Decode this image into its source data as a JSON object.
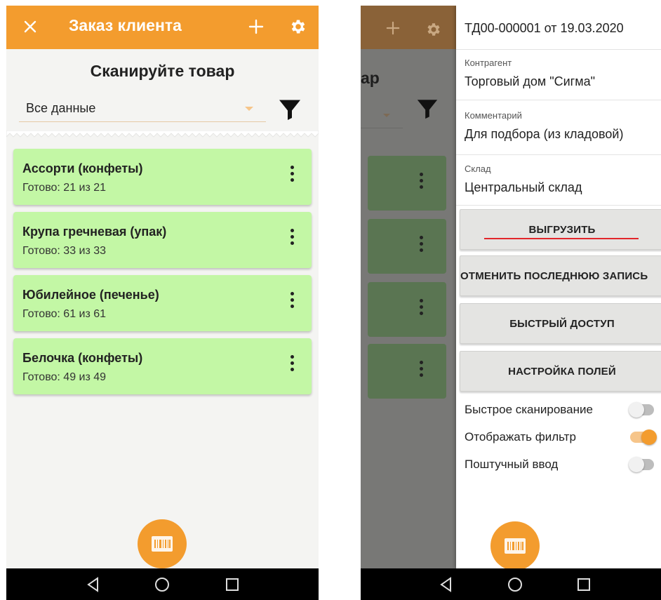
{
  "left": {
    "title": "Заказ клиента",
    "scan_title": "Сканируйте товар",
    "filter_value": "Все данные",
    "items": [
      {
        "title": "Ассорти (конфеты)",
        "status": "Готово: 21 из 21"
      },
      {
        "title": "Крупа гречневая (упак)",
        "status": "Готово: 33 из 33"
      },
      {
        "title": "Юбилейное (печенье)",
        "status": "Готово: 61 из 61"
      },
      {
        "title": "Белочка (конфеты)",
        "status": "Готово: 49 из 49"
      }
    ]
  },
  "right": {
    "bg_title_fragment": "ар",
    "drawer": {
      "document": "ТД00-000001 от 19.03.2020",
      "fields": [
        {
          "label": "Контрагент",
          "value": "Торговый дом \"Сигма\""
        },
        {
          "label": "Комментарий",
          "value": "Для подбора (из кладовой)"
        },
        {
          "label": "Склад",
          "value": "Центральный склад"
        }
      ],
      "buttons": [
        "ВЫГРУЗИТЬ",
        "ОТМЕНИТЬ ПОСЛЕДНЮЮ ЗАПИСЬ",
        "БЫСТРЫЙ ДОСТУП",
        "НАСТРОЙКА ПОЛЕЙ"
      ],
      "toggles": [
        {
          "label": "Быстрое сканирование",
          "state": "off"
        },
        {
          "label": "Отображать фильтр",
          "state": "on"
        },
        {
          "label": "Поштучный ввод",
          "state": "off"
        }
      ]
    }
  },
  "colors": {
    "accent": "#f39c2e",
    "card": "#c3f7a5",
    "highlight_line": "#e2262b"
  },
  "icons": [
    "close-icon",
    "plus-icon",
    "gear-icon",
    "filter-icon",
    "more-vert-icon",
    "barcode-icon",
    "back-icon",
    "home-icon",
    "recents-icon"
  ]
}
